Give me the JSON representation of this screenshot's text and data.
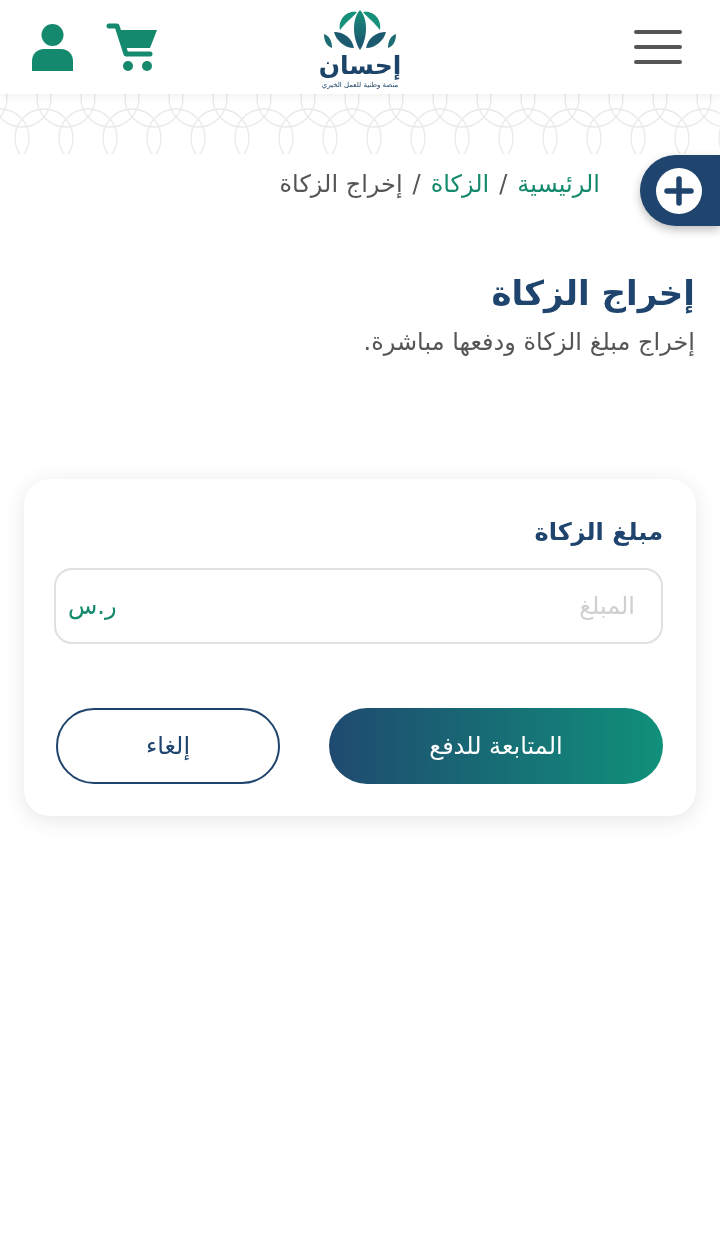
{
  "header": {
    "logo": {
      "name": "إحسان",
      "tagline": "منصة وطنية للعمل الخيري"
    }
  },
  "breadcrumb": {
    "items": [
      {
        "label": "الرئيسية",
        "link": true
      },
      {
        "label": "الزكاة",
        "link": true
      },
      {
        "label": "إخراج الزكاة",
        "link": false
      }
    ],
    "separators": [
      "/",
      "/"
    ]
  },
  "page": {
    "title": "إخراج الزكاة",
    "description": "إخراج مبلغ الزكاة ودفعها مباشرة."
  },
  "form": {
    "label": "مبلغ الزكاة",
    "amount_field": {
      "placeholder": "المبلغ",
      "currency": "ر.س"
    },
    "buttons": [
      {
        "label": "المتابعة للدفع",
        "kind": "primary"
      },
      {
        "label": "إلغاء",
        "kind": "secondary"
      }
    ]
  }
}
